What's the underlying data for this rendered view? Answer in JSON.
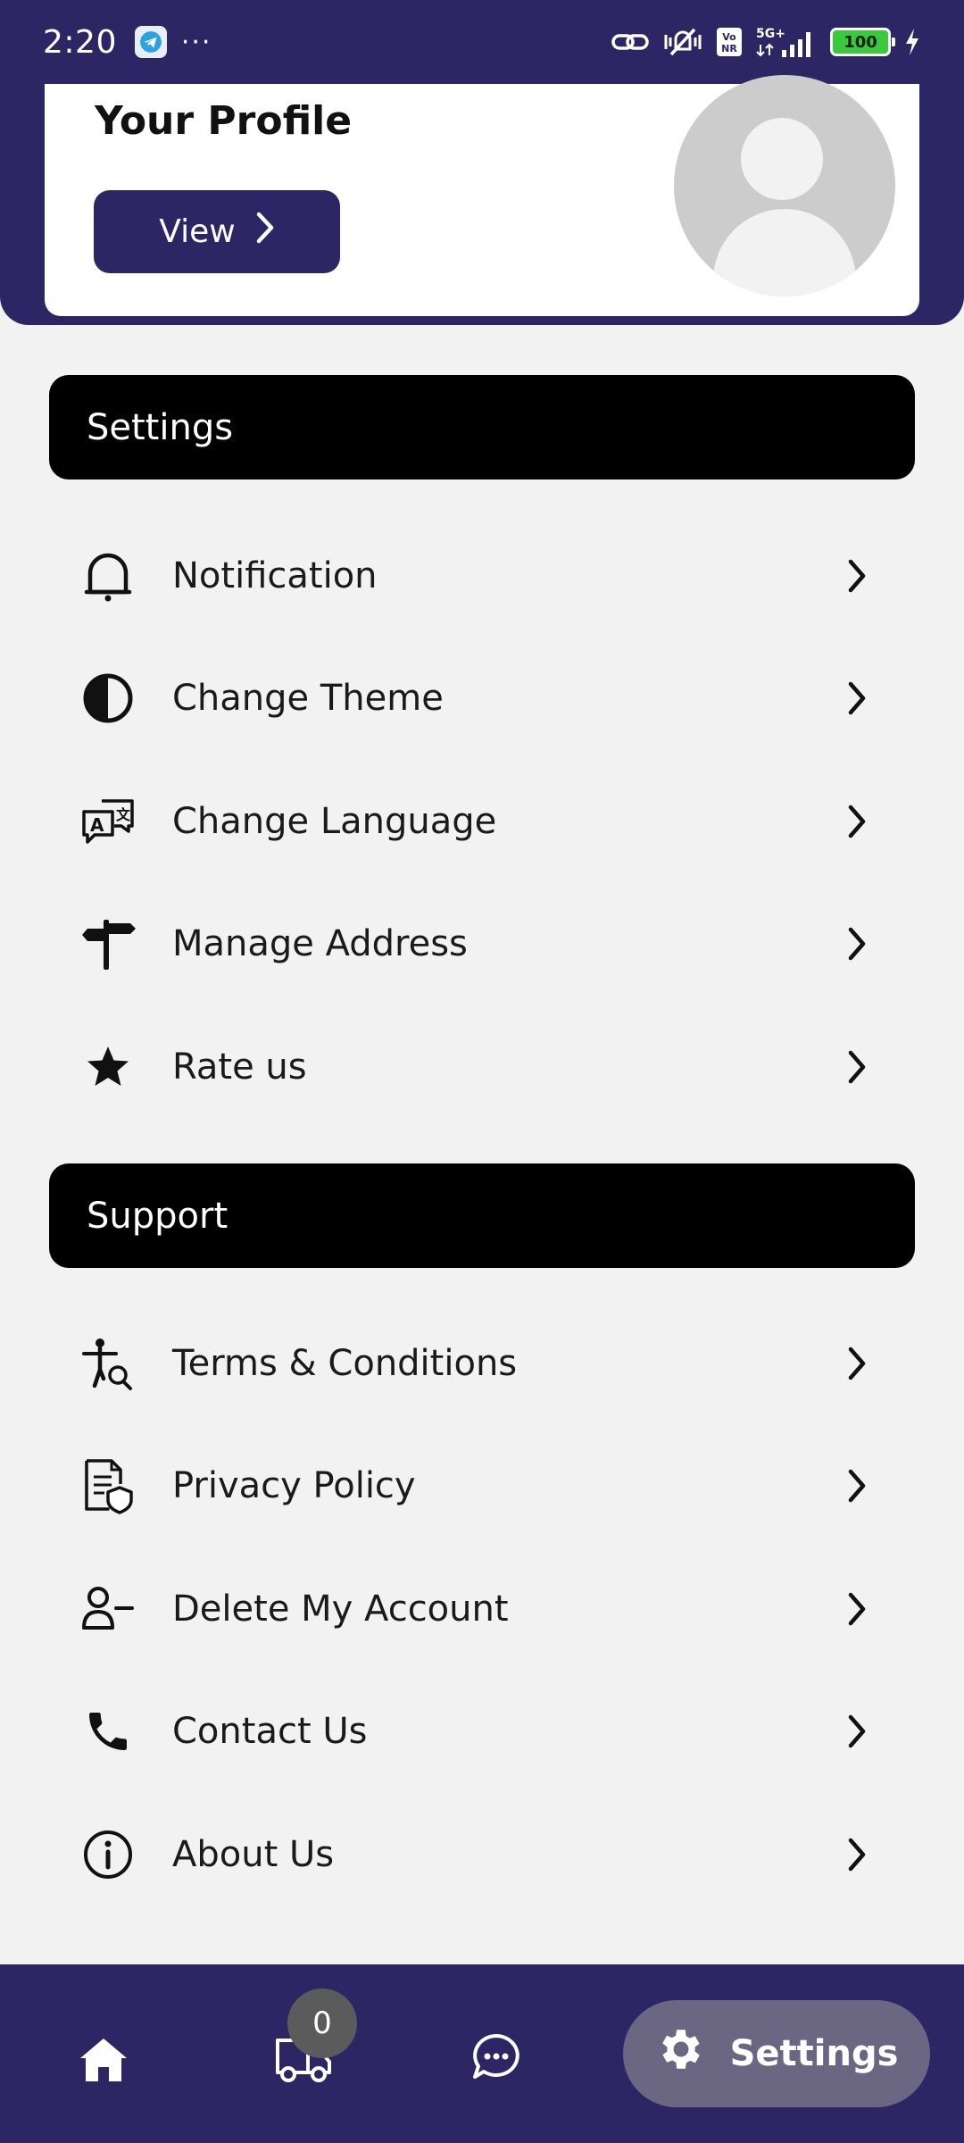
{
  "status_bar": {
    "time": "2:20",
    "dots": "···",
    "network": "5G+",
    "battery": "100",
    "vo_nr": "Vo NR"
  },
  "profile": {
    "title": "Your Profile",
    "view_label": "View"
  },
  "settings_section": {
    "title": "Settings",
    "items": [
      {
        "label": "Notification",
        "icon": "bell-icon"
      },
      {
        "label": "Change Theme",
        "icon": "theme-icon"
      },
      {
        "label": "Change Language",
        "icon": "translate-icon"
      },
      {
        "label": "Manage Address",
        "icon": "signpost-icon"
      },
      {
        "label": "Rate us",
        "icon": "star-icon"
      }
    ]
  },
  "support_section": {
    "title": "Support",
    "items": [
      {
        "label": "Terms & Conditions",
        "icon": "terms-icon"
      },
      {
        "label": "Privacy Policy",
        "icon": "privacy-policy-icon"
      },
      {
        "label": "Delete My Account",
        "icon": "user-minus-icon"
      },
      {
        "label": "Contact Us",
        "icon": "phone-icon"
      },
      {
        "label": "About Us",
        "icon": "info-icon"
      }
    ]
  },
  "bottom_nav": {
    "cart_count": "0",
    "settings_label": "Settings"
  },
  "colors": {
    "primary": "#2c2664",
    "section_bg": "#000000",
    "page_bg": "#f2f2f2",
    "active_nav": "#6b6783"
  }
}
